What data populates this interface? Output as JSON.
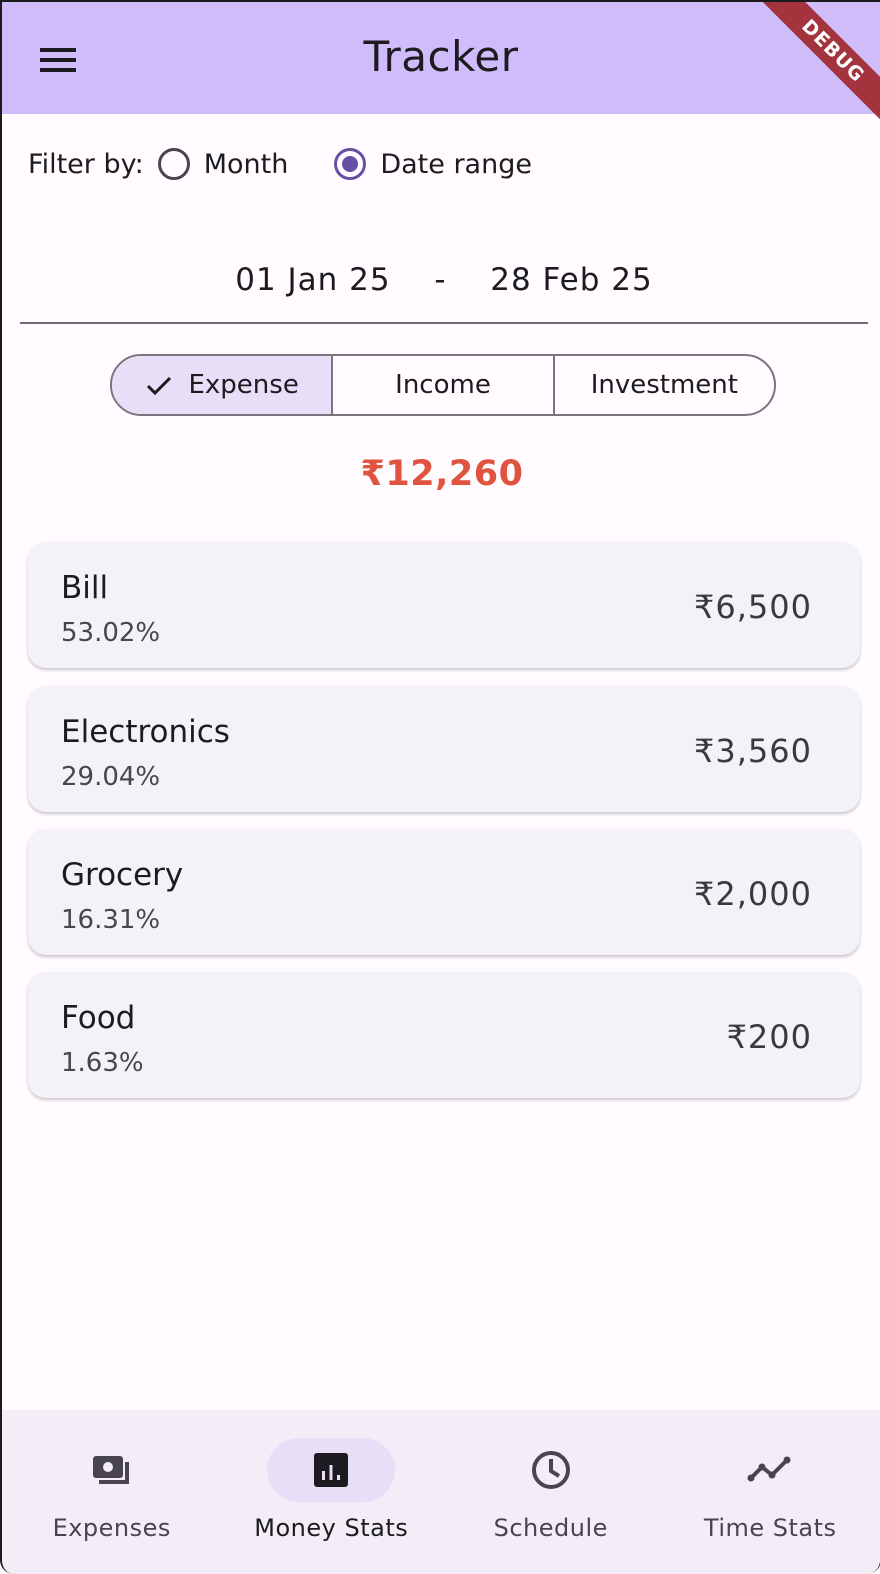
{
  "appbar": {
    "title": "Tracker",
    "debug_banner": "DEBUG"
  },
  "filter": {
    "label": "Filter by:",
    "options": [
      {
        "label": "Month",
        "selected": false
      },
      {
        "label": "Date range",
        "selected": true
      }
    ]
  },
  "date_range": {
    "start": "01 Jan 25",
    "separator": "-",
    "end": "28 Feb 25"
  },
  "segments": [
    {
      "label": "Expense",
      "selected": true
    },
    {
      "label": "Income",
      "selected": false
    },
    {
      "label": "Investment",
      "selected": false
    }
  ],
  "total": "₹12,260",
  "colors": {
    "accent": "#6750a4",
    "appbar": "#d0bcfb",
    "total": "#e0533f",
    "selected": "#e8def8"
  },
  "categories": [
    {
      "name": "Bill",
      "percent": "53.02%",
      "amount": "₹6,500"
    },
    {
      "name": "Electronics",
      "percent": "29.04%",
      "amount": "₹3,560"
    },
    {
      "name": "Grocery",
      "percent": "16.31%",
      "amount": "₹2,000"
    },
    {
      "name": "Food",
      "percent": "1.63%",
      "amount": "₹200"
    }
  ],
  "bottom_nav": [
    {
      "label": "Expenses",
      "icon": "payments-icon",
      "active": false
    },
    {
      "label": "Money Stats",
      "icon": "bar-chart-icon",
      "active": true
    },
    {
      "label": "Schedule",
      "icon": "clock-icon",
      "active": false
    },
    {
      "label": "Time Stats",
      "icon": "trend-line-icon",
      "active": false
    }
  ]
}
